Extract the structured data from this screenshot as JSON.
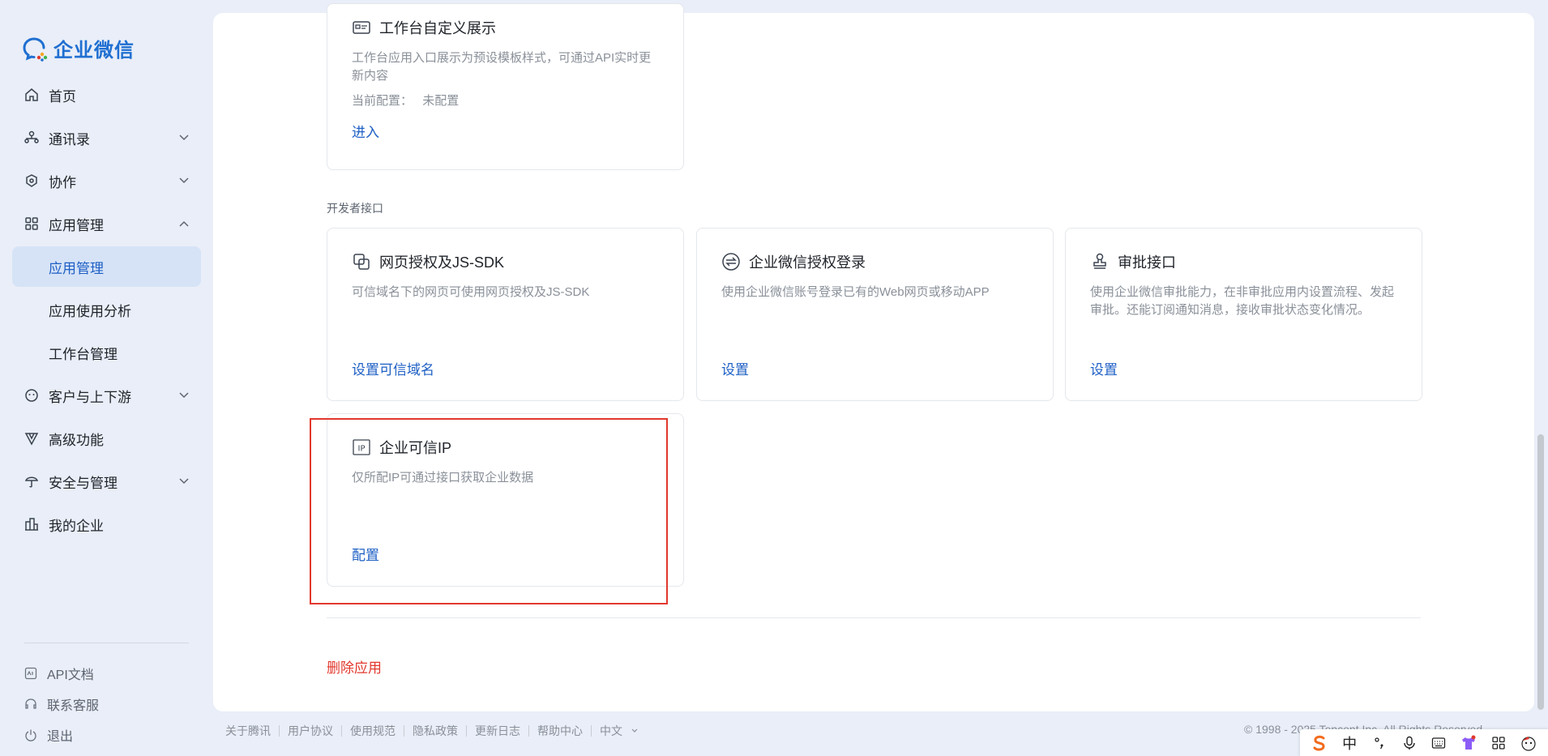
{
  "brand": {
    "name": "企业微信"
  },
  "sidebar": {
    "items": [
      {
        "label": "首页",
        "icon": "home-icon"
      },
      {
        "label": "通讯录",
        "icon": "contacts-icon"
      },
      {
        "label": "协作",
        "icon": "collaboration-icon"
      },
      {
        "label": "应用管理",
        "icon": "apps-icon"
      },
      {
        "label": "应用管理"
      },
      {
        "label": "应用使用分析"
      },
      {
        "label": "工作台管理"
      },
      {
        "label": "客户与上下游",
        "icon": "customer-icon"
      },
      {
        "label": "高级功能",
        "icon": "advanced-icon"
      },
      {
        "label": "安全与管理",
        "icon": "security-icon"
      },
      {
        "label": "我的企业",
        "icon": "company-icon"
      }
    ],
    "footer": [
      {
        "label": "API文档",
        "icon": "api-doc-icon"
      },
      {
        "label": "联系客服",
        "icon": "headset-icon"
      },
      {
        "label": "退出",
        "icon": "power-icon"
      }
    ]
  },
  "main": {
    "workbench_card": {
      "title": "工作台自定义展示",
      "desc": "工作台应用入口展示为预设模板样式，可通过API实时更新内容",
      "config_label": "当前配置：",
      "config_value": "未配置",
      "link": "进入"
    },
    "section_label": "开发者接口",
    "api_cards": [
      {
        "title": "网页授权及JS-SDK",
        "desc": "可信域名下的网页可使用网页授权及JS-SDK",
        "link": "设置可信域名",
        "icon": "copy-icon"
      },
      {
        "title": "企业微信授权登录",
        "desc": "使用企业微信账号登录已有的Web网页或移动APP",
        "link": "设置",
        "icon": "exchange-icon"
      },
      {
        "title": "审批接口",
        "desc": "使用企业微信审批能力，在非审批应用内设置流程、发起审批。还能订阅通知消息，接收审批状态变化情况。",
        "link": "设置",
        "icon": "stamp-icon"
      },
      {
        "title": "企业可信IP",
        "desc": "仅所配IP可通过接口获取企业数据",
        "link": "配置",
        "icon": "ip-icon"
      }
    ],
    "delete_label": "删除应用"
  },
  "footer": {
    "links": [
      "关于腾讯",
      "用户协议",
      "使用规范",
      "隐私政策",
      "更新日志",
      "帮助中心",
      "中文"
    ],
    "copyright": "© 1998 - 2025 Tencent Inc. All Rights Reserved"
  },
  "ime": {
    "lang": "中"
  },
  "colors": {
    "accent": "#1d5fc4",
    "danger": "#e2382d",
    "background": "#e9eef8"
  }
}
